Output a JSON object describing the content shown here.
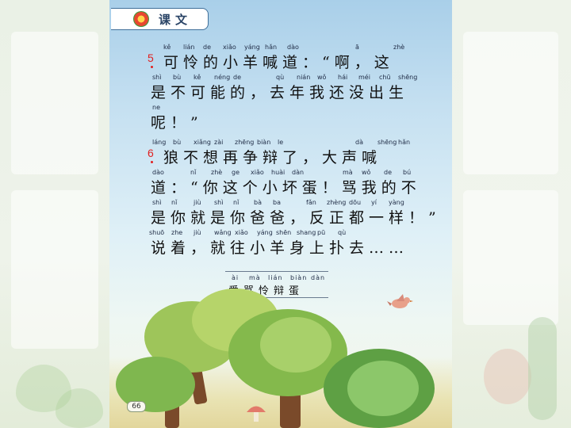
{
  "header": {
    "title": "课文"
  },
  "paragraphs": [
    {
      "number": "5",
      "lines": [
        {
          "pinyin": [
            "kě",
            "lián",
            "de",
            "xiǎo",
            "yáng",
            "hǎn",
            "dào",
            "ā",
            "zhè"
          ],
          "text": "可怜的小羊喊道：“啊，这"
        },
        {
          "pinyin": [
            "shì",
            "bù",
            "kě",
            "néng",
            "de",
            "qù",
            "nián",
            "wǒ",
            "hái",
            "méi",
            "chū",
            "shēng"
          ],
          "text": "是不可能的，去年我还没出生"
        },
        {
          "pinyin": [
            "ne"
          ],
          "text": "呢！”"
        }
      ]
    },
    {
      "number": "6",
      "lines": [
        {
          "pinyin": [
            "láng",
            "bù",
            "xiǎng",
            "zài",
            "zhēng",
            "biàn",
            "le",
            "dà",
            "shēng",
            "hǎn"
          ],
          "text": "狼不想再争辩了，大声喊"
        },
        {
          "pinyin": [
            "dào",
            "nǐ",
            "zhè",
            "ge",
            "xiǎo",
            "huài",
            "dàn",
            "mà",
            "wǒ",
            "de",
            "bú"
          ],
          "text": "道：“你这个小坏蛋！骂我的不"
        },
        {
          "pinyin": [
            "shì",
            "nǐ",
            "jiù",
            "shì",
            "nǐ",
            "bà",
            "ba",
            "fǎn",
            "zhèng",
            "dōu",
            "yí",
            "yàng"
          ],
          "text": "是你就是你爸爸，反正都一样！”"
        },
        {
          "pinyin": [
            "shuō",
            "zhe",
            "jiù",
            "wǎng",
            "xiǎo",
            "yáng",
            "shēn",
            "shang",
            "pū",
            "qù"
          ],
          "text": "说着，就往小羊身上扑去……"
        }
      ]
    }
  ],
  "vocab": {
    "pinyin": [
      "ài",
      "mà",
      "lián",
      "biàn",
      "dàn"
    ],
    "text": "爱骂怜辩蛋"
  },
  "page_number": "66",
  "colors": {
    "paragraph_number": "#e02020",
    "header_border": "#3f6f9a"
  }
}
